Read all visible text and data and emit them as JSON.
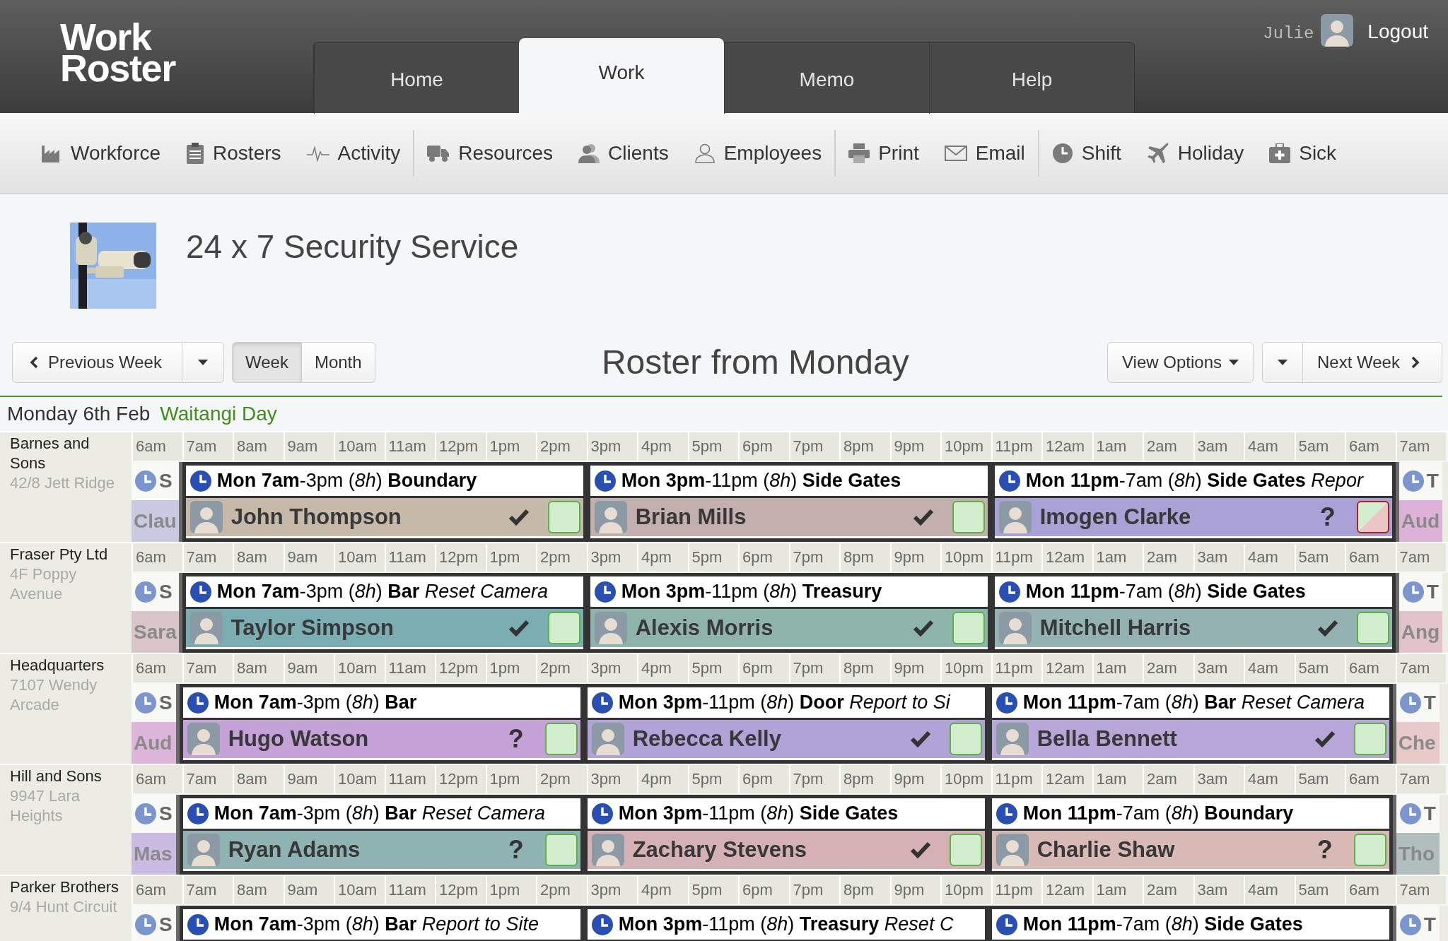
{
  "app": {
    "logo": "Work Roster"
  },
  "nav_tabs": [
    {
      "label": "Home",
      "selected": false
    },
    {
      "label": "Work",
      "selected": true
    },
    {
      "label": "Memo",
      "selected": false
    },
    {
      "label": "Help",
      "selected": false
    }
  ],
  "user": {
    "name": "Julie",
    "action": "Logout"
  },
  "toolbar": {
    "groups": [
      [
        "Workforce",
        "Rosters",
        "Activity"
      ],
      [
        "Resources",
        "Clients",
        "Employees"
      ],
      [
        "Print",
        "Email"
      ],
      [
        "Shift",
        "Holiday",
        "Sick"
      ]
    ]
  },
  "site": {
    "title": "24 x 7 Security Service"
  },
  "navigation": {
    "previous": "Previous Week",
    "views": [
      {
        "label": "Week",
        "selected": true
      },
      {
        "label": "Month",
        "selected": false
      }
    ],
    "title": "Roster from Monday",
    "options": "View Options",
    "next": "Next Week"
  },
  "day": {
    "date": "Monday 6th Feb",
    "holiday": "Waitangi Day"
  },
  "rows": [
    {
      "client": "Barnes and Sons",
      "address": "42/8 Jett Ridge",
      "hours": [
        "6am",
        "7am",
        "8am",
        "9am",
        "10am",
        "11am",
        "12pm",
        "1pm",
        "2pm",
        "3pm",
        "4pm",
        "5pm",
        "6pm",
        "7pm",
        "8pm",
        "9pm",
        "10pm",
        "11pm",
        "12am",
        "1am",
        "2am",
        "3am",
        "4am",
        "5am",
        "6am",
        "7am"
      ],
      "shifts": [
        {
          "kind": "partial",
          "label": "S",
          "name": "Clau",
          "color": "#c9c9e2"
        },
        {
          "kind": "shift",
          "title": "**Mon 7am**-3pm (*8h*) **Boundary**",
          "employee": "John Thompson",
          "color": "#c6b9a9",
          "confirmed": true,
          "clash": false
        },
        {
          "kind": "shift",
          "title": "**Mon 3pm**-11pm (*8h*) **Side Gates**",
          "employee": "Brian Mills",
          "color": "#c4afaf",
          "confirmed": true,
          "clash": false
        },
        {
          "kind": "shift",
          "title": "**Mon 11pm**-7am (*8h*) **Side Gates** *Repor*",
          "employee": "Imogen Clarke",
          "color": "#aaa1d7",
          "confirmed": false,
          "query": "?",
          "clash": true
        },
        {
          "kind": "partial",
          "label": "T",
          "name": "Aud",
          "color": "#dcb2d9"
        }
      ]
    },
    {
      "client": "Fraser Pty Ltd",
      "address": "4F Poppy Avenue",
      "hours": [
        "6am",
        "7am",
        "8am",
        "9am",
        "10am",
        "11am",
        "12pm",
        "1pm",
        "2pm",
        "3pm",
        "4pm",
        "5pm",
        "6pm",
        "7pm",
        "8pm",
        "9pm",
        "10pm",
        "11pm",
        "12am",
        "1am",
        "2am",
        "3am",
        "4am",
        "5am",
        "6am",
        "7am"
      ],
      "shifts": [
        {
          "kind": "partial",
          "label": "S",
          "name": "Sara",
          "color": "#d9c5c9"
        },
        {
          "kind": "shift",
          "title": "**Mon 7am**-3pm (*8h*) **Bar** *Reset Camera*",
          "employee": "Taylor Simpson",
          "color": "#7aaeb3",
          "confirmed": true,
          "clash": false
        },
        {
          "kind": "shift",
          "title": "**Mon 3pm**-11pm (*8h*) **Treasury**",
          "employee": "Alexis Morris",
          "color": "#8fb4ac",
          "confirmed": true,
          "clash": false
        },
        {
          "kind": "shift",
          "title": "**Mon 11pm**-7am (*8h*) **Side Gates**",
          "employee": "Mitchell Harris",
          "color": "#94b2b2",
          "confirmed": true,
          "clash": false
        },
        {
          "kind": "partial",
          "label": "T",
          "name": "Ang",
          "color": "#e1c3c9"
        }
      ]
    },
    {
      "client": "Headquarters",
      "address": "7107 Wendy Arcade",
      "hours": [
        "6am",
        "7am",
        "8am",
        "9am",
        "10am",
        "11am",
        "12pm",
        "1pm",
        "2pm",
        "3pm",
        "4pm",
        "5pm",
        "6pm",
        "7pm",
        "8pm",
        "9pm",
        "10pm",
        "11pm",
        "12am",
        "1am",
        "2am",
        "3am",
        "4am",
        "5am",
        "6am",
        "7am"
      ],
      "shifts": [
        {
          "kind": "partial",
          "label": "S",
          "name": "Aud",
          "color": "#ddb5da"
        },
        {
          "kind": "shift",
          "title": "**Mon 7am**-3pm (*8h*) **Bar**",
          "employee": "Hugo Watson",
          "color": "#c4a1d7",
          "confirmed": false,
          "query": "?",
          "clash": false
        },
        {
          "kind": "shift",
          "title": "**Mon 3pm**-11pm (*8h*) **Door** *Report to Si*",
          "employee": "Rebecca Kelly",
          "color": "#b1a2d7",
          "confirmed": true,
          "clash": false
        },
        {
          "kind": "shift",
          "title": "**Mon 11pm**-7am (*8h*) **Bar** *Reset Camera*",
          "employee": "Bella Bennett",
          "color": "#b9a6d8",
          "confirmed": true,
          "clash": false
        },
        {
          "kind": "partial",
          "label": "T",
          "name": "Che",
          "color": "#e8c9c9"
        }
      ]
    },
    {
      "client": "Hill and Sons",
      "address": "9947 Lara Heights",
      "hours": [
        "6am",
        "7am",
        "8am",
        "9am",
        "10am",
        "11am",
        "12pm",
        "1pm",
        "2pm",
        "3pm",
        "4pm",
        "5pm",
        "6pm",
        "7pm",
        "8pm",
        "9pm",
        "10pm",
        "11pm",
        "12am",
        "1am",
        "2am",
        "3am",
        "4am",
        "5am",
        "6am",
        "7am"
      ],
      "shifts": [
        {
          "kind": "partial",
          "label": "S",
          "name": "Mas",
          "color": "#cbbbe2"
        },
        {
          "kind": "shift",
          "title": "**Mon 7am**-3pm (*8h*) **Bar** *Reset Camera*",
          "employee": "Ryan Adams",
          "color": "#8fb2b2",
          "confirmed": false,
          "query": "?",
          "clash": false
        },
        {
          "kind": "shift",
          "title": "**Mon 3pm**-11pm (*8h*) **Side Gates**",
          "employee": "Zachary Stevens",
          "color": "#d5b1b6",
          "confirmed": true,
          "clash": false
        },
        {
          "kind": "shift",
          "title": "**Mon 11pm**-7am (*8h*) **Boundary**",
          "employee": "Charlie Shaw",
          "color": "#d8b9b6",
          "confirmed": false,
          "query": "?",
          "clash": false
        },
        {
          "kind": "partial",
          "label": "T",
          "name": "Tho",
          "color": "#b2bebe"
        }
      ]
    },
    {
      "client": "Parker Brothers",
      "address": "9/4 Hunt Circuit",
      "hours": [
        "6am",
        "7am",
        "8am",
        "9am",
        "10am",
        "11am",
        "12pm",
        "1pm",
        "2pm",
        "3pm",
        "4pm",
        "5pm",
        "6pm",
        "7pm",
        "8pm",
        "9pm",
        "10pm",
        "11pm",
        "12am",
        "1am",
        "2am",
        "3am",
        "4am",
        "5am",
        "6am",
        "7am"
      ],
      "shifts": [
        {
          "kind": "partial",
          "label": "S"
        },
        {
          "kind": "shift",
          "title": "**Mon 7am**-3pm (*8h*) **Bar** *Report to Site*"
        },
        {
          "kind": "shift",
          "title": "**Mon 3pm**-11pm (*8h*) **Treasury** *Reset C*"
        },
        {
          "kind": "shift",
          "title": "**Mon 11pm**-7am (*8h*) **Side Gates**"
        },
        {
          "kind": "partial",
          "label": "T"
        }
      ]
    }
  ]
}
